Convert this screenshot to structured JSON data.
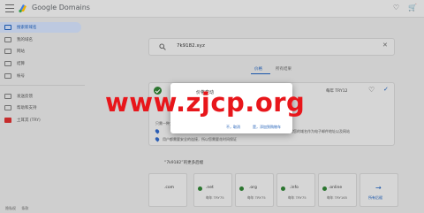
{
  "header": {
    "brand": "Google Domains",
    "icons": [
      "menu-icon",
      "google-logo-icon",
      "heart-icon",
      "cart-icon"
    ],
    "cart_count": "0"
  },
  "sidebar": {
    "items": [
      {
        "label": "搜索新域名",
        "icon": "search-icon"
      },
      {
        "label": "我的域名",
        "icon": "globe-icon"
      },
      {
        "label": "网站",
        "icon": "web-icon"
      },
      {
        "label": "结算",
        "icon": "card-icon"
      },
      {
        "label": "帐号",
        "icon": "person-icon"
      },
      {
        "label": "发送反馈",
        "icon": "feedback-icon"
      },
      {
        "label": "帮助和支持",
        "icon": "help-icon"
      },
      {
        "label": "土耳其 (TRY)",
        "icon": "flag-icon"
      }
    ],
    "footer_left": "隐私权",
    "footer_right": "条款"
  },
  "search": {
    "value": "7k9182.xyz"
  },
  "tabs": [
    {
      "label": "价格"
    },
    {
      "label": "所有结果"
    }
  ],
  "result": {
    "price": "每年 TRY12",
    "row1_suffix": "进行付款后即可使用您的域名作为电子邮件地址以及网站",
    "row2": "只需一种工具",
    "row3": "用户都需要安全的连接，所以您需要花时间保证"
  },
  "suggestions": {
    "title": "“7k9182”的更多后缀",
    "tlds": [
      {
        "name": ".com",
        "price": ""
      },
      {
        "name": ".net",
        "price": "每年 TRY75"
      },
      {
        "name": ".org",
        "price": "每年 TRY75"
      },
      {
        "name": ".info",
        "price": "每年 TRY75"
      },
      {
        "name": ".online",
        "price": "每年 TRY165"
      }
    ],
    "more": "所有后缀"
  },
  "dialog": {
    "title": "价格变动",
    "cancel": "不，取消",
    "ok": "是，添加到购物车"
  },
  "watermark": "www.zjcp.org",
  "colors": {
    "accent": "#1a5bb5",
    "success": "#2e7d32",
    "watermark": "#e8161b"
  }
}
